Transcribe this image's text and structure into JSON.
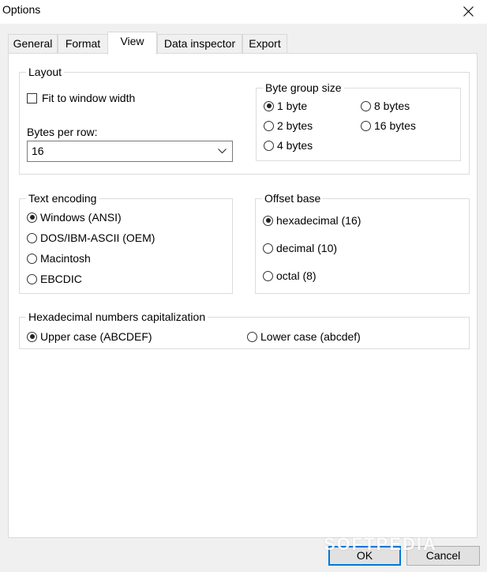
{
  "window": {
    "title": "Options"
  },
  "tabs": [
    "General",
    "Format",
    "View",
    "Data inspector",
    "Export"
  ],
  "layout": {
    "legend": "Layout",
    "fit_to_window": {
      "label": "Fit to window width",
      "checked": false
    },
    "bytes_per_row": {
      "label": "Bytes per row:",
      "value": "16"
    },
    "byte_group": {
      "legend": "Byte group size",
      "options": [
        "1 byte",
        "2 bytes",
        "4 bytes",
        "8 bytes",
        "16 bytes"
      ],
      "selected": "1 byte"
    }
  },
  "text_encoding": {
    "legend": "Text encoding",
    "options": [
      "Windows (ANSI)",
      "DOS/IBM-ASCII (OEM)",
      "Macintosh",
      "EBCDIC"
    ],
    "selected": "Windows (ANSI)"
  },
  "offset_base": {
    "legend": "Offset base",
    "options": [
      "hexadecimal (16)",
      "decimal (10)",
      "octal (8)"
    ],
    "selected": "hexadecimal (16)"
  },
  "hex_caps": {
    "legend": "Hexadecimal numbers capitalization",
    "options": [
      "Upper case (ABCDEF)",
      "Lower case (abcdef)"
    ],
    "selected": "Upper case (ABCDEF)"
  },
  "buttons": {
    "ok": "OK",
    "cancel": "Cancel"
  },
  "watermark": "SOFTPEDIA"
}
